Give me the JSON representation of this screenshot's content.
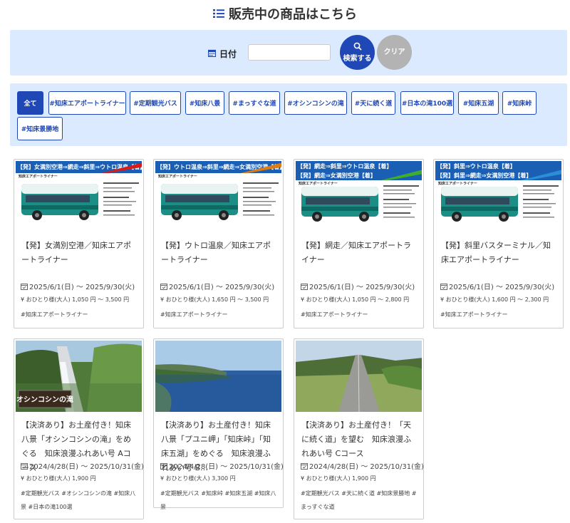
{
  "header": {
    "title": "販売中の商品はこちら",
    "icon": "list-icon"
  },
  "search": {
    "date_label": "日付",
    "date_value": "",
    "date_placeholder": "",
    "search_label": "検索する",
    "clear_label": "クリア"
  },
  "tags": [
    {
      "label": "全て",
      "active": true
    },
    {
      "label": "#知床エアポートライナー"
    },
    {
      "label": "#定期観光バス"
    },
    {
      "label": "#知床八景"
    },
    {
      "label": "#まっすぐな道"
    },
    {
      "label": "#オシンコシンの滝"
    },
    {
      "label": "#天に続く道"
    },
    {
      "label": "#日本の滝100選"
    },
    {
      "label": "#知床五湖"
    },
    {
      "label": "#知床峠"
    },
    {
      "label": "#知床景勝地"
    }
  ],
  "cards": [
    {
      "banner": "【発】女満別空港⇒網走⇒斜里⇒ウトロ温泉【着】",
      "banner_sub": "知床エアポートライナー",
      "title": "【発】女満別空港／知床エアポートライナー",
      "date": "2025/6/1(日) 〜 2025/9/30(火)",
      "price": "¥ おひとり様(大人) 1,050 円 〜 3,500 円",
      "tags": "#知床エアポートライナー"
    },
    {
      "banner": "【発】ウトロ温泉⇒斜里⇒網走⇒女満別空港【着】",
      "banner_sub": "知床エアポートライナー",
      "title": "【発】ウトロ温泉／知床エアポートライナー",
      "date": "2025/6/1(日) 〜 2025/9/30(火)",
      "price": "¥ おひとり様(大人) 1,650 円 〜 3,500 円",
      "tags": "#知床エアポートライナー"
    },
    {
      "banner": "【発】網走⇒斜里⇒ウトロ温泉【着】",
      "banner2": "【発】網走⇒女満別空港【着】",
      "banner_sub": "知床エアポートライナー",
      "title": "【発】網走／知床エアポートライナー",
      "date": "2025/6/1(日) 〜 2025/9/30(火)",
      "price": "¥ おひとり様(大人) 1,050 円 〜 2,800 円",
      "tags": "#知床エアポートライナー"
    },
    {
      "banner": "【発】斜里⇒ウトロ温泉【着】",
      "banner2": "【発】斜里⇒網走⇒女満別空港【着】",
      "banner_sub": "知床エアポートライナー",
      "title": "【発】斜里バスターミナル／知床エアポートライナー",
      "date": "2025/6/1(日) 〜 2025/9/30(火)",
      "price": "¥ おひとり様(大人) 1,600 円 〜 2,300 円",
      "tags": "#知床エアポートライナー"
    },
    {
      "photo": "waterfall",
      "title": "【決済あり】お土産付き！知床八景「オシンコシンの滝」をめぐる　知床浪漫ふれあい号 Aコース",
      "date": "2024/4/28(日) 〜 2025/10/31(金)",
      "price": "¥ おひとり様(大人) 1,900 円",
      "tags": "#定期観光バス #オシンコシンの滝 #知床八景 #日本の滝100選"
    },
    {
      "photo": "coast",
      "title": "【決済あり】お土産付き！知床八景「プユニ岬」「知床峠」「知床五湖」をめぐる　知床浪漫ふれあい号 B…",
      "date": "2024/4/28(日) 〜 2025/10/31(金)",
      "price": "¥ おひとり様(大人) 3,300 円",
      "tags": "#定期観光バス #知床峠 #知床五湖 #知床八景"
    },
    {
      "photo": "road",
      "title": "【決済あり】お土産付き！「天に続く道」を望む　知床浪漫ふれあい号 Cコース",
      "date": "2024/4/28(日) 〜 2025/10/31(金)",
      "price": "¥ おひとり様(大人) 1,900 円",
      "tags": "#定期観光バス #天に続く道 #知床景勝地 #まっすぐな道"
    }
  ],
  "waterfall_sign": "オシンコシンの滝",
  "colors": {
    "accent": "#2047b6",
    "panel": "#dbeafe",
    "clear": "#b3b3b3"
  }
}
